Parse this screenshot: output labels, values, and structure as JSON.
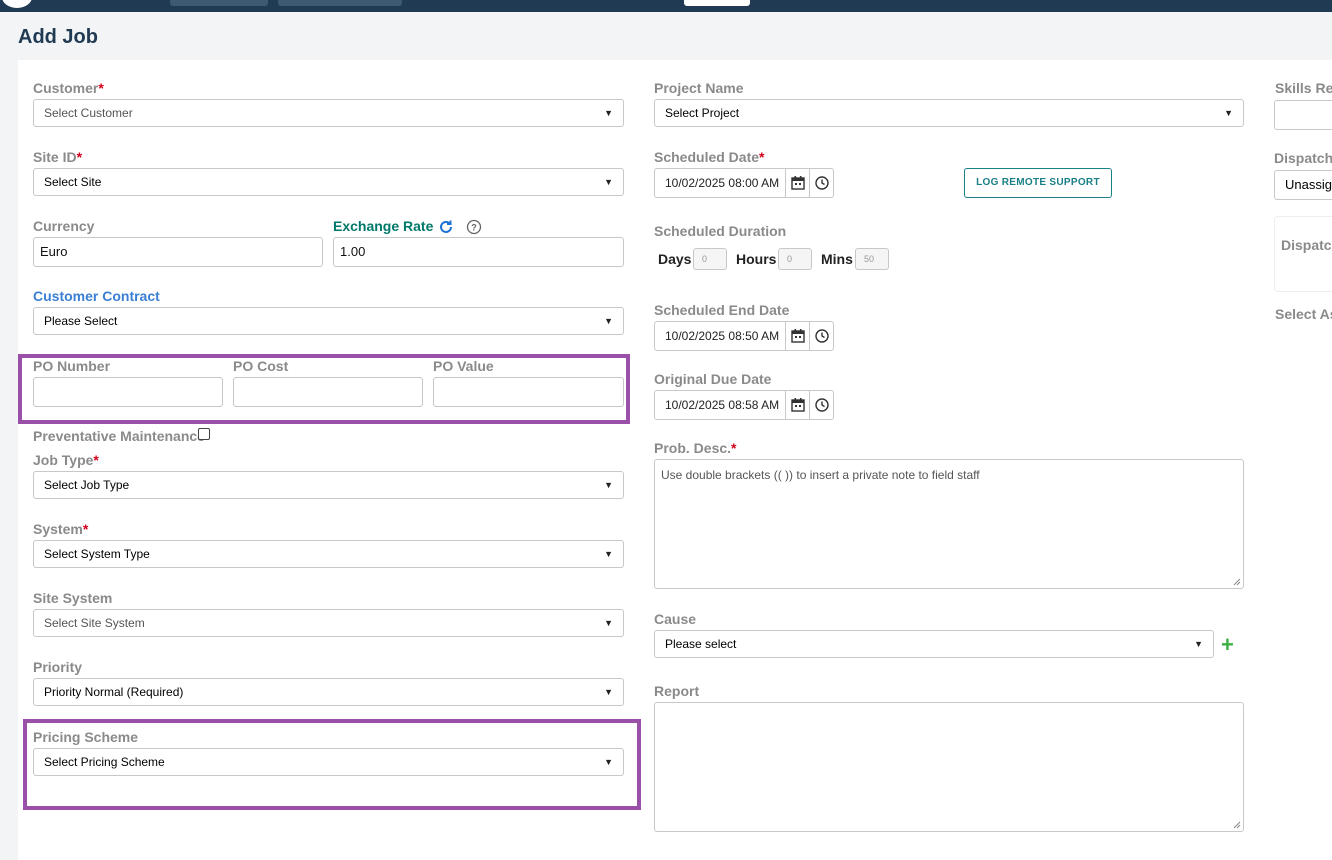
{
  "page": {
    "title": "Add Job"
  },
  "customer": {
    "label": "Customer",
    "required_mark": "*",
    "placeholder": "Select Customer"
  },
  "site_id": {
    "label": "Site ID",
    "required_mark": "*",
    "value": "Select Site"
  },
  "currency": {
    "label": "Currency",
    "value": "Euro"
  },
  "exchange_rate": {
    "label": "Exchange Rate",
    "value": "1.00"
  },
  "customer_contract": {
    "label": "Customer Contract",
    "value": "Please Select"
  },
  "po_number": {
    "label": "PO Number",
    "value": ""
  },
  "po_cost": {
    "label": "PO Cost",
    "value": ""
  },
  "po_value": {
    "label": "PO Value",
    "value": ""
  },
  "preventative_maintenance": {
    "label": "Preventative Maintenance",
    "checked": false
  },
  "job_type": {
    "label": "Job Type",
    "required_mark": "*",
    "value": "Select Job Type"
  },
  "system": {
    "label": "System",
    "required_mark": "*",
    "value": "Select System Type"
  },
  "site_system": {
    "label": "Site System",
    "placeholder": "Select Site System"
  },
  "priority": {
    "label": "Priority",
    "value": "Priority Normal (Required)"
  },
  "pricing_scheme": {
    "label": "Pricing Scheme",
    "value": "Select Pricing Scheme"
  },
  "project_name": {
    "label": "Project Name",
    "value": "Select Project"
  },
  "scheduled_date": {
    "label": "Scheduled Date",
    "required_mark": "*",
    "value": "10/02/2025 08:00 AM"
  },
  "log_remote_support": {
    "label": "LOG REMOTE SUPPORT"
  },
  "scheduled_duration": {
    "label": "Scheduled Duration",
    "days_label": "Days",
    "days_value": "0",
    "hours_label": "Hours",
    "hours_value": "0",
    "mins_label": "Mins",
    "mins_value": "50"
  },
  "scheduled_end_date": {
    "label": "Scheduled End Date",
    "value": "10/02/2025 08:50 AM"
  },
  "original_due_date": {
    "label": "Original Due Date",
    "value": "10/02/2025 08:58 AM"
  },
  "prob_desc": {
    "label": "Prob. Desc.",
    "required_mark": "*",
    "placeholder": "Use double brackets (( )) to insert a private note to field staff"
  },
  "cause": {
    "label": "Cause",
    "value": "Please select"
  },
  "report": {
    "label": "Report",
    "value": ""
  },
  "skills_required": {
    "label": "Skills Rec"
  },
  "dispatch": {
    "label": "Dispatch",
    "value": "Unassig"
  },
  "dispatch_panel": {
    "label": "Dispatc"
  },
  "select_assets": {
    "label": "Select As"
  },
  "icons": {
    "calendar": "calendar-icon",
    "clock": "clock-icon",
    "refresh": "refresh-icon",
    "help": "help-icon",
    "dropdown": "chevron-down-icon",
    "add": "plus-icon"
  },
  "colors": {
    "header_bg": "#1f3a52",
    "highlight": "#9a4fa8",
    "teal": "#00796b",
    "link_blue": "#3a7fd4",
    "required": "#d0021b",
    "add_green": "#3cb043"
  }
}
